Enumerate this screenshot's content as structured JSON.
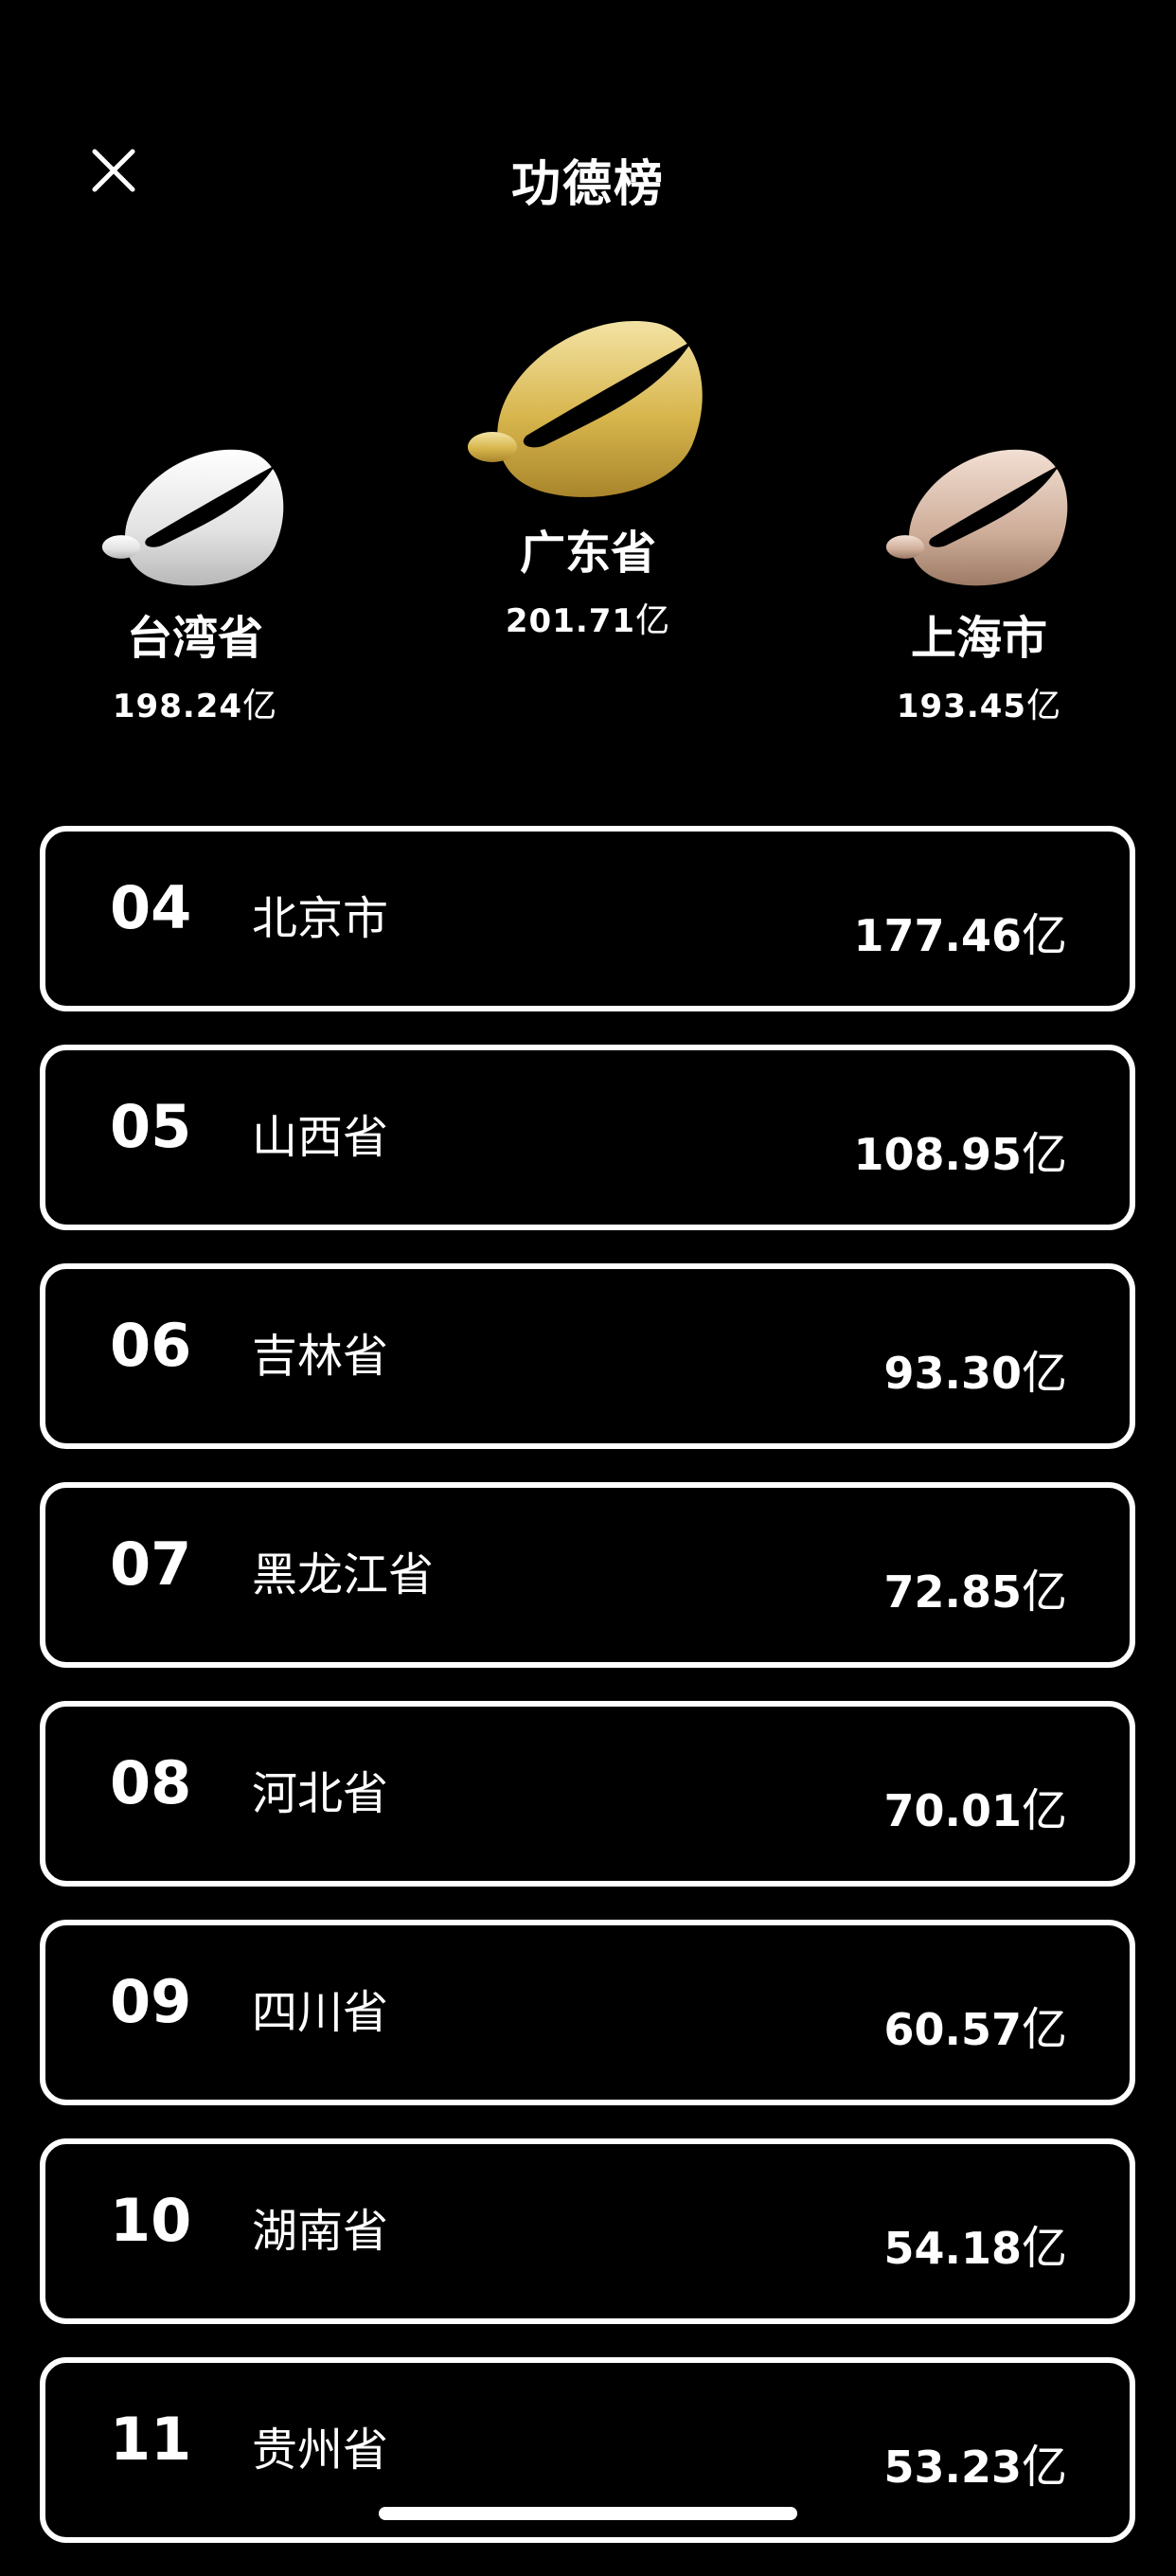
{
  "header": {
    "title": "功德榜",
    "close_icon": "close-icon"
  },
  "podium": {
    "first": {
      "rank": 1,
      "name": "广东省",
      "score": "201.71",
      "unit": "亿",
      "color": "#d4b44a"
    },
    "second": {
      "rank": 2,
      "name": "台湾省",
      "score": "198.24",
      "unit": "亿",
      "color": "#e8e8e8"
    },
    "third": {
      "rank": 3,
      "name": "上海市",
      "score": "193.45",
      "unit": "亿",
      "color": "#c9a894"
    }
  },
  "ranking": [
    {
      "rank": "04",
      "name": "北京市",
      "score": "177.46",
      "unit": "亿"
    },
    {
      "rank": "05",
      "name": "山西省",
      "score": "108.95",
      "unit": "亿"
    },
    {
      "rank": "06",
      "name": "吉林省",
      "score": "93.30",
      "unit": "亿"
    },
    {
      "rank": "07",
      "name": "黑龙江省",
      "score": "72.85",
      "unit": "亿"
    },
    {
      "rank": "08",
      "name": "河北省",
      "score": "70.01",
      "unit": "亿"
    },
    {
      "rank": "09",
      "name": "四川省",
      "score": "60.57",
      "unit": "亿"
    },
    {
      "rank": "10",
      "name": "湖南省",
      "score": "54.18",
      "unit": "亿"
    },
    {
      "rank": "11",
      "name": "贵州省",
      "score": "53.23",
      "unit": "亿"
    }
  ]
}
